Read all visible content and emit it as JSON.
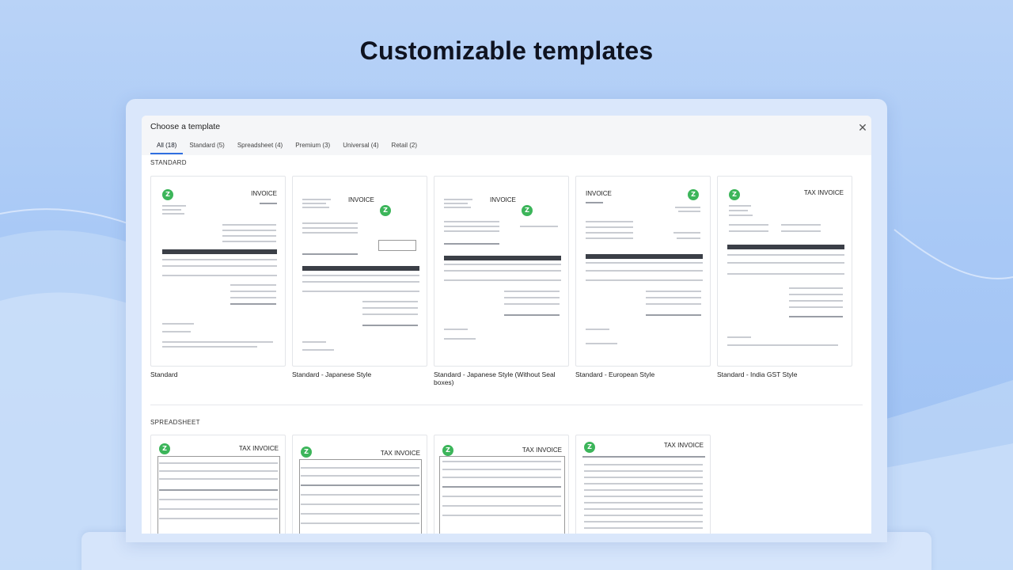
{
  "headline": "Customizable templates",
  "dialog": {
    "title": "Choose a template",
    "close_icon": "close-icon"
  },
  "tabs": [
    {
      "label": "All (18)",
      "active": true
    },
    {
      "label": "Standard (5)",
      "active": false
    },
    {
      "label": "Spreadsheet (4)",
      "active": false
    },
    {
      "label": "Premium (3)",
      "active": false
    },
    {
      "label": "Universal (4)",
      "active": false
    },
    {
      "label": "Retail (2)",
      "active": false
    }
  ],
  "sections": {
    "standard": "STANDARD",
    "spreadsheet": "SPREADSHEET"
  },
  "standard_templates": [
    {
      "label": "Standard",
      "heading": "INVOICE"
    },
    {
      "label": "Standard - Japanese Style",
      "heading": "INVOICE"
    },
    {
      "label": "Standard - Japanese Style (Without Seal boxes)",
      "heading": "INVOICE"
    },
    {
      "label": "Standard - European Style",
      "heading": "INVOICE"
    },
    {
      "label": "Standard - India GST Style",
      "heading": "TAX INVOICE"
    }
  ],
  "spreadsheet_templates": [
    {
      "heading": "TAX INVOICE"
    },
    {
      "heading": "TAX INVOICE"
    },
    {
      "heading": "TAX INVOICE"
    },
    {
      "heading": "TAX INVOICE"
    }
  ],
  "logo_letter": "Z",
  "colors": {
    "accent": "#2f6fe0",
    "logo": "#3cb55a",
    "background": "#a9c9f6"
  }
}
